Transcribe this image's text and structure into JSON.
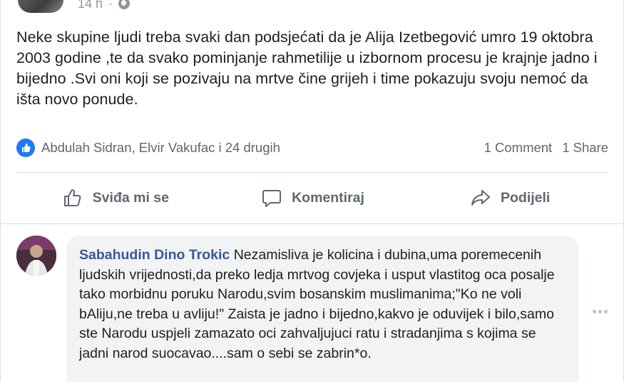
{
  "post": {
    "timestamp": "14 h",
    "privacy_icon": "globe-icon",
    "text": "Neke skupine ljudi treba svaki dan podsjećati da je Alija Izetbegović umro 19 oktobra 2003 godine ,te da svako pominjanje rahmetilije u izbornom procesu je krajnje jadno i bijedno .Svi oni koji se pozivaju na mrtve čine grijeh i time pokazuju svoju nemoć da išta novo ponude.",
    "reactors": "Abdulah Sidran, Elvir Vakufac i 24 drugih",
    "comments_count": "1 Comment",
    "shares_count": "1 Share"
  },
  "actions": {
    "like_label": "Sviđa mi se",
    "comment_label": "Komentiraj",
    "share_label": "Podijeli"
  },
  "comment": {
    "author": "Sabahudin Dino Trokic",
    "text": "Nezamisliva je kolicina i dubina,uma poremecenih ljudskih vrijednosti,da preko ledja mrtvog covjeka i usput vlastitog oca posalje tako morbidnu poruku Narodu,svim bosanskim muslimanima;\"Ko ne voli bAliju,ne treba u avliju!\" Zaista je jadno i bijedno,kakvo je oduvijek i bilo,samo ste Narodu uspjeli zamazato oci zahvaljujuci ratu i stradanjima s kojima se jadni narod suocavao....sam o sebi se zabrin*o."
  },
  "colors": {
    "accent": "#2078f4",
    "link": "#385898",
    "muted": "#606770",
    "bubble": "#f2f3f5"
  }
}
